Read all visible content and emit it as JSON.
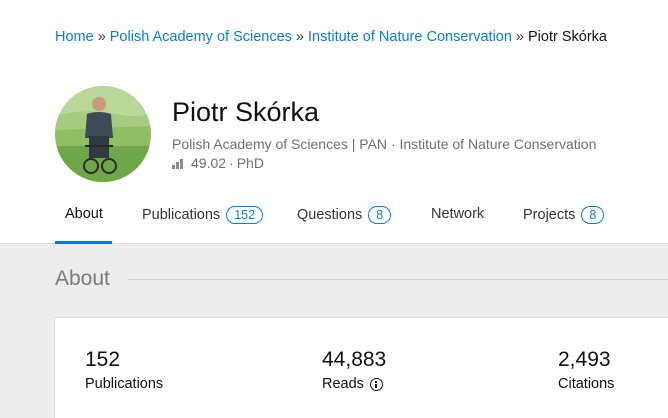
{
  "breadcrumb": {
    "home": "Home",
    "sep": "»",
    "academy": "Polish Academy of Sciences",
    "institute": "Institute of Nature Conservation",
    "current": "Piotr Skórka"
  },
  "profile": {
    "name": "Piotr Skórka",
    "affiliation": "Polish Academy of Sciences | PAN · Institute of Nature Conservation",
    "score": "49.02",
    "dot": "·",
    "degree": "PhD",
    "score_icon": "bar-chart-icon",
    "avatar": "profile-photo"
  },
  "tabs": [
    {
      "label": "About",
      "active": true
    },
    {
      "label": "Publications",
      "count": "152"
    },
    {
      "label": "Questions",
      "count": "8"
    },
    {
      "label": "Network"
    },
    {
      "label": "Projects",
      "count": "8"
    }
  ],
  "section": {
    "title": "About"
  },
  "stats": [
    {
      "value": "152",
      "label": "Publications"
    },
    {
      "value": "44,883",
      "label": "Reads",
      "icon": "info-icon"
    },
    {
      "value": "2,493",
      "label": "Citations"
    }
  ],
  "colors": {
    "link": "#0a7bd0",
    "muted_text": "#6f6f6f",
    "page_bg": "#ededed"
  }
}
